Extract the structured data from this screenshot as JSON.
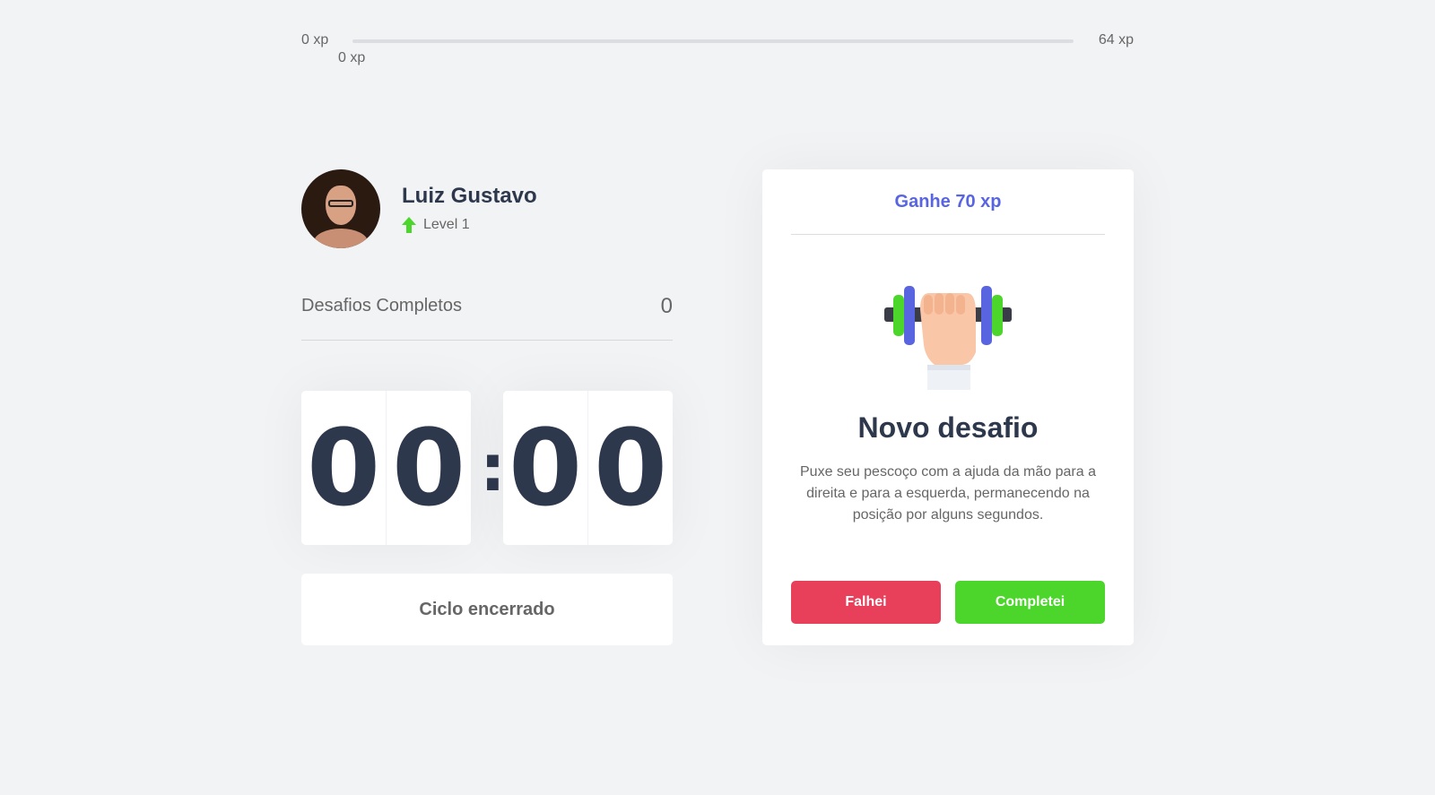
{
  "xp_bar": {
    "min_label": "0 xp",
    "max_label": "64 xp",
    "current_label": "0 xp",
    "progress_percent": 0
  },
  "profile": {
    "name": "Luiz Gustavo",
    "level_label": "Level 1",
    "level_icon": "level-up-arrow-icon"
  },
  "completed": {
    "label": "Desafios Completos",
    "count": "0"
  },
  "countdown": {
    "minute_left": "0",
    "minute_right": "0",
    "separator": ":",
    "second_left": "0",
    "second_right": "0"
  },
  "cycle_button": {
    "label": "Ciclo encerrado"
  },
  "challenge": {
    "header": "Ganhe 70 xp",
    "icon": "dumbbell-icon",
    "title": "Novo desafio",
    "description": "Puxe seu pescoço com a ajuda da mão para a direita e para a esquerda, permanecendo na posição por alguns segundos.",
    "fail_label": "Falhei",
    "success_label": "Completei"
  },
  "colors": {
    "background": "#f2f3f5",
    "title": "#2e384d",
    "text": "#666666",
    "accent_blue": "#5965e0",
    "green": "#4cd62b",
    "red": "#e83f5b"
  }
}
